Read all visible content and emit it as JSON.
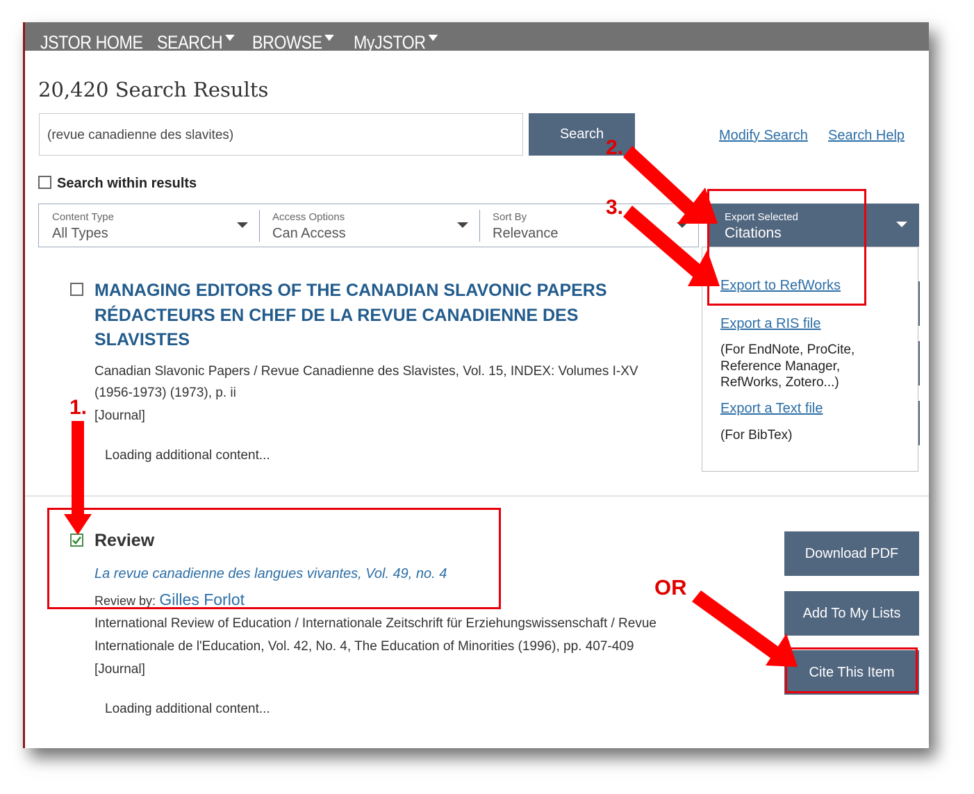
{
  "nav": {
    "home": "JSTOR HOME",
    "search": "SEARCH",
    "browse": "BROWSE",
    "myjstor": "MyJSTOR"
  },
  "page": {
    "title": "20,420 Search Results"
  },
  "search": {
    "query": "(revue canadienne des slavites)",
    "button": "Search",
    "modify": "Modify Search",
    "help": "Search Help",
    "within_label": "Search within results"
  },
  "filters": {
    "content_type": {
      "label": "Content Type",
      "value": "All Types"
    },
    "access": {
      "label": "Access Options",
      "value": "Can Access"
    },
    "sort": {
      "label": "Sort By",
      "value": "Relevance"
    }
  },
  "export": {
    "label": "Export Selected",
    "value": "Citations",
    "menu": {
      "refworks": "Export to RefWorks",
      "ris": "Export a RIS file",
      "ris_note_1": "(For EndNote, ProCite,",
      "ris_note_2": "Reference Manager,",
      "ris_note_3": "RefWorks, Zotero...)",
      "text": "Export a Text file",
      "text_note": "(For BibTex)"
    }
  },
  "results": [
    {
      "title_1": "MANAGING EDITORS OF THE CANADIAN SLAVONIC PAPERS",
      "title_2": "RÉDACTEURS EN CHEF DE LA REVUE CANADIENNE DES",
      "title_3": "SLAVISTES",
      "source_1": "Canadian Slavonic Papers / Revue Canadienne des Slavistes, Vol. 15, INDEX: Volumes I-XV",
      "source_2": "(1956-1973) (1973), p. ii",
      "type": "[Journal]",
      "loading": "Loading additional content...",
      "checked": false
    },
    {
      "title": "Review",
      "subtitle": "La revue canadienne des langues vivantes, Vol. 49, no. 4",
      "reviewer_label": "Review by:",
      "reviewer": "Gilles Forlot",
      "source_1": "International Review of Education / Internationale Zeitschrift für Erziehungswissenschaft / Revue",
      "source_2": "Internationale de l'Education, Vol. 42, No. 4, The Education of Minorities (1996), pp. 407-409",
      "type": "[Journal]",
      "loading": "Loading additional content...",
      "checked": true
    }
  ],
  "actions": {
    "download": "Download PDF",
    "add_list": "Add To My Lists",
    "cite": "Cite This Item"
  },
  "annotations": {
    "step1": "1.",
    "step2": "2.",
    "step3": "3.",
    "or": "OR"
  },
  "colors": {
    "nav_bg": "#727272",
    "button_bg": "#51667f",
    "link": "#2c6ea6",
    "result_title": "#225b8c",
    "annotation": "#e8000b"
  }
}
